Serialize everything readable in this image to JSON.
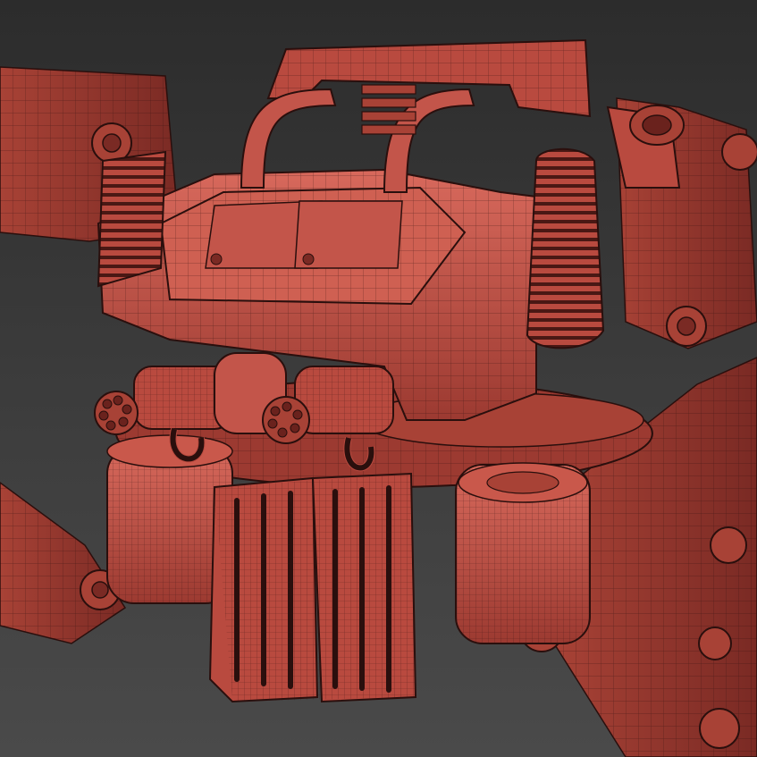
{
  "viewport": {
    "background_top": "#2c2c2c",
    "background_bottom": "#4a4a4a"
  },
  "model": {
    "subject": "mech-walker-wireframe",
    "shading": "wireframe-on-shaded",
    "base_color": "#b94a3f",
    "light_color": "#d8695c",
    "dark_color": "#7a2a24",
    "wire_color": "#2a0f0d"
  }
}
